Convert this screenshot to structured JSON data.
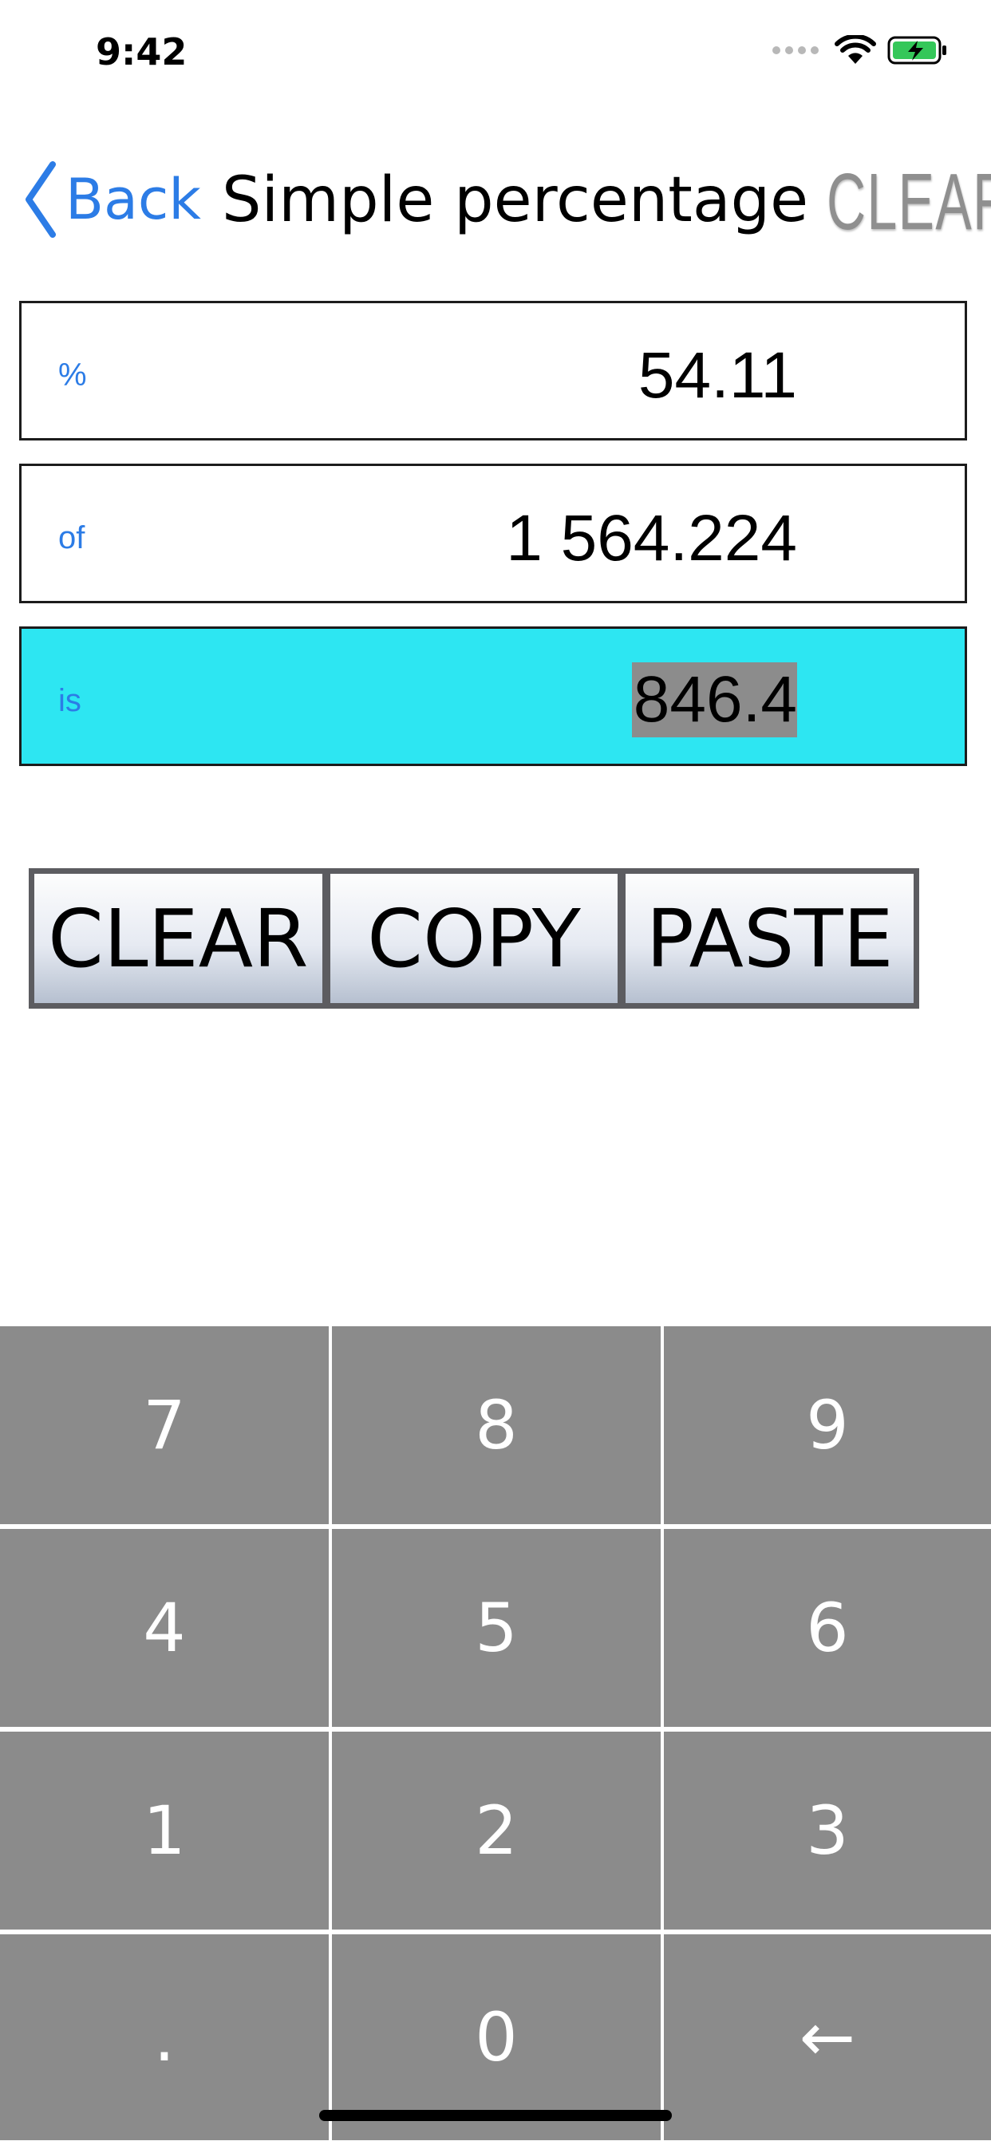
{
  "status_bar": {
    "time": "9:42"
  },
  "nav": {
    "back_label": "Back",
    "title": "Simple percentage",
    "clear_label": "CLEAR"
  },
  "fields": [
    {
      "label": "%",
      "value": "54.11"
    },
    {
      "label": "of",
      "value": "1 564.224"
    },
    {
      "label": "is",
      "value": "846.4"
    }
  ],
  "actions": {
    "clear": "CLEAR",
    "copy": "COPY",
    "paste": "PASTE"
  },
  "keypad": {
    "keys": [
      "7",
      "8",
      "9",
      "4",
      "5",
      "6",
      "1",
      "2",
      "3",
      ".",
      "0",
      "←"
    ]
  },
  "colors": {
    "accent": "#2c7ce6",
    "result_background": "#2de6f2",
    "key_background": "#8b8b8b"
  }
}
